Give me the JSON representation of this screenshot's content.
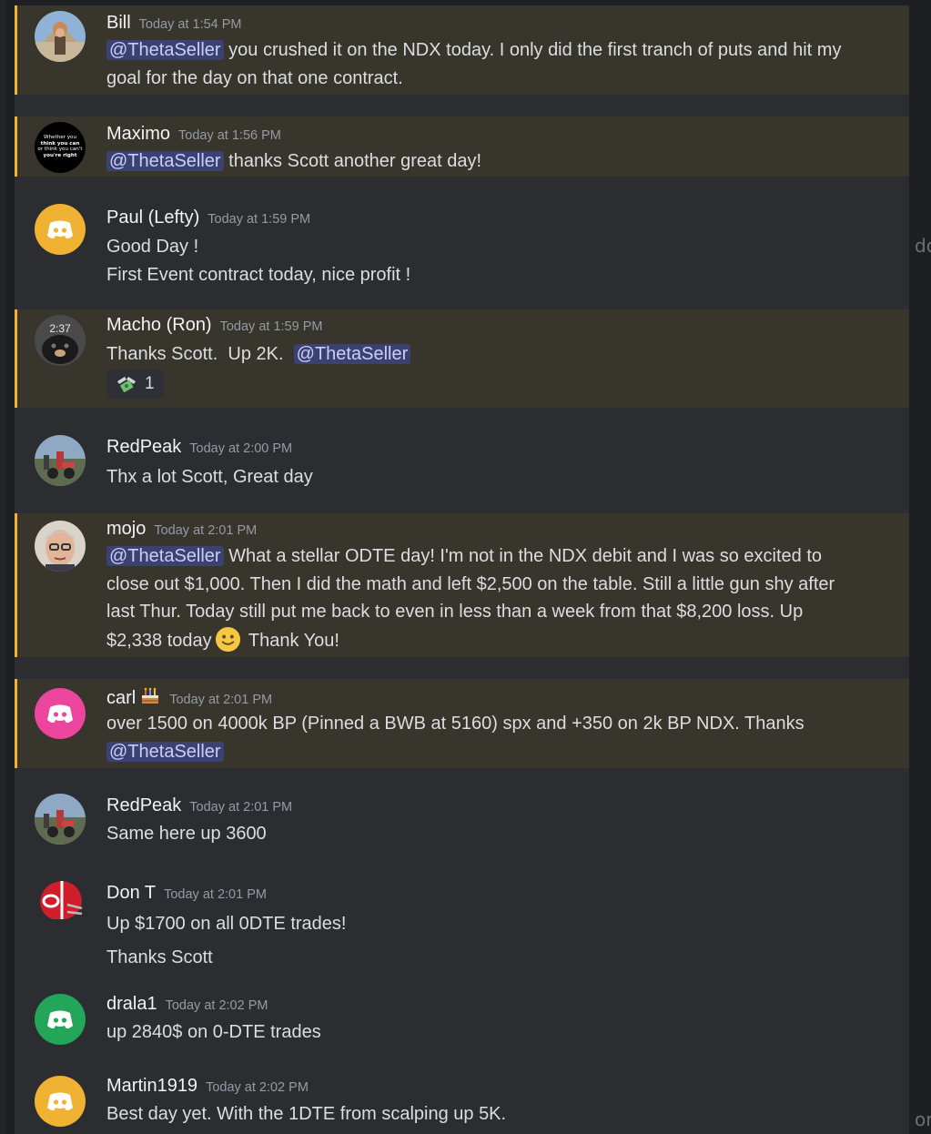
{
  "messages": [
    {
      "author": "Bill",
      "time": "Today at 1:54 PM",
      "mention": "@ThetaSeller",
      "text": " you crushed it on the NDX today. I only did the first tranch of puts and hit my goal for the day on that one contract."
    },
    {
      "author": "Maximo",
      "time": "Today at 1:56 PM",
      "mention": "@ThetaSeller",
      "text": " thanks Scott another great day!",
      "avatar_text": [
        "Whether you",
        "think you can",
        "or think you can't",
        "you're right"
      ]
    },
    {
      "author": "Paul  (Lefty)",
      "time": "Today at 1:59 PM",
      "line1": "Good Day !",
      "line2": "First Event contract today, nice profit !"
    },
    {
      "author": "Macho (Ron)",
      "time": "Today at 1:59 PM",
      "text": "Thanks Scott.  Up 2K.  ",
      "mention": "@ThetaSeller",
      "reaction_count": "1",
      "avatar_text": "2:37"
    },
    {
      "author": "RedPeak",
      "time": "Today at 2:00 PM",
      "text": "Thx a lot Scott, Great day"
    },
    {
      "author": "mojo",
      "time": "Today at 2:01 PM",
      "mention": "@ThetaSeller",
      "text": " What a stellar ODTE day! I'm not in the NDX debit and I was so excited to close out $1,000. Then I did the math and left $2,500 on the table. Still a little gun shy after last Thur. Today still put me back to even in less than a week from that $8,200 loss. Up $2,338 today",
      "text_after": " Thank You!"
    },
    {
      "author": "carl",
      "time": "Today at 2:01 PM",
      "text": "over 1500 on 4000k BP (Pinned a BWB at 5160) spx and +350 on 2k  BP NDX. Thanks ",
      "mention": "@ThetaSeller"
    },
    {
      "author": "RedPeak",
      "time": "Today at 2:01 PM",
      "text": "Same here up 3600"
    },
    {
      "author": "Don T",
      "time": "Today at 2:01 PM",
      "line1": "Up $1700 on all 0DTE trades!",
      "line2": "Thanks Scott"
    },
    {
      "author": "drala1",
      "time": "Today at 2:02 PM",
      "text": "up 2840$ on 0-DTE trades"
    },
    {
      "author": "Martin1919",
      "time": "Today at 2:02 PM",
      "text": "Best day yet.  With the 1DTE from scalping up 5K."
    }
  ],
  "edge_text": {
    "right_top": "do",
    "right_bottom": "ork"
  },
  "colors": {
    "background": "#2b2d31",
    "highlight_background": "#37352c",
    "highlight_bar": "#f0b232",
    "mention_bg": "#3c4270",
    "mention_text": "#c9cdfb",
    "discord_orange": "#f0b232",
    "discord_pink": "#eb459e",
    "discord_green": "#23a55a"
  },
  "icons": {
    "reaction_emoji": "money-with-wings-icon",
    "inline_emoji": "slightly-smiling-face-icon",
    "name_badge": "birthday-cake-icon",
    "default_avatar": "discord-logo-icon"
  }
}
